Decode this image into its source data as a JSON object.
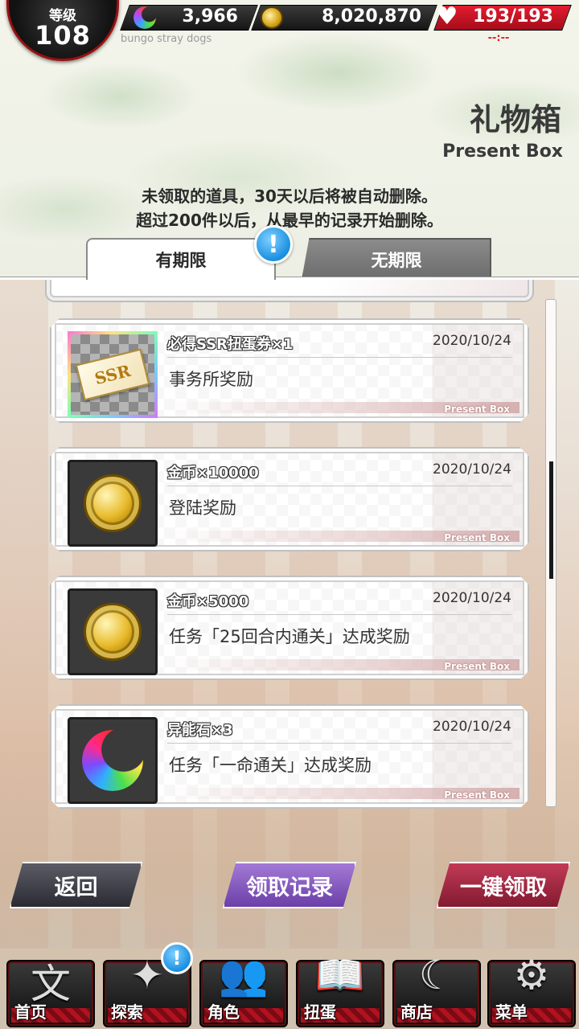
{
  "status": {
    "level_label": "等级",
    "level": "108",
    "stones": "3,966",
    "coins": "8,020,870",
    "stamina": "193/193",
    "stamina_timer": "--:--",
    "caption": "bungo stray dogs",
    "stone_icon": "moon-stone-icon",
    "coin_icon": "coin-icon",
    "heart_icon": "heart-icon"
  },
  "header": {
    "title": "礼物箱",
    "subtitle": "Present Box",
    "notice_line1": "未领取的道具，30天以后将被自动删除。",
    "notice_line2": "超过200件以后，从最早的记录开始删除。"
  },
  "tabs": [
    {
      "label": "有期限",
      "active": true
    },
    {
      "label": "无期限",
      "active": false
    }
  ],
  "alert_mark": "!",
  "items": [
    {
      "name": "必得SSR扭蛋券×1",
      "date": "2020/10/24",
      "desc": "事务所奖励",
      "tag": "Present Box",
      "icon": "ssr-ticket-icon",
      "ticket_text": "SSR"
    },
    {
      "name": "金币×10000",
      "date": "2020/10/24",
      "desc": "登陆奖励",
      "tag": "Present Box",
      "icon": "gold-coin-icon"
    },
    {
      "name": "金币×5000",
      "date": "2020/10/24",
      "desc": "任务「25回合内通关」达成奖励",
      "tag": "Present Box",
      "icon": "gold-coin-icon"
    },
    {
      "name": "异能石×3",
      "date": "2020/10/24",
      "desc": "任务「一命通关」达成奖励",
      "tag": "Present Box",
      "icon": "ability-stone-icon"
    }
  ],
  "actions": {
    "back": "返回",
    "record": "领取记录",
    "claim_all": "一键领取"
  },
  "nav": [
    {
      "label": "首页",
      "icon": "home-icon",
      "glyph": "文"
    },
    {
      "label": "探索",
      "icon": "explore-icon",
      "glyph": "✦"
    },
    {
      "label": "角色",
      "icon": "characters-icon",
      "glyph": "👥"
    },
    {
      "label": "扭蛋",
      "icon": "gacha-book-icon",
      "glyph": "📖"
    },
    {
      "label": "商店",
      "icon": "shop-icon",
      "glyph": "☾"
    },
    {
      "label": "菜单",
      "icon": "menu-gear-icon",
      "glyph": "⚙"
    }
  ],
  "colors": {
    "accent_red": "#e31c2f",
    "alert_blue": "#1a8fe0",
    "record_purple": "#6b3fa8",
    "claim_red": "#821a30"
  }
}
